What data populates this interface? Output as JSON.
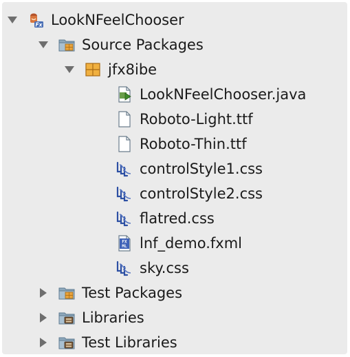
{
  "tree": {
    "project": {
      "label": "LookNFeelChooser",
      "icon": "javafx-project-icon",
      "expanded": true
    },
    "source_packages": {
      "label": "Source Packages",
      "icon": "source-folder-icon",
      "expanded": true
    },
    "package": {
      "label": "jfx8ibe",
      "icon": "package-icon",
      "expanded": true
    },
    "files": [
      {
        "label": "LookNFeelChooser.java",
        "icon": "java-file-icon"
      },
      {
        "label": "Roboto-Light.ttf",
        "icon": "blank-file-icon"
      },
      {
        "label": "Roboto-Thin.ttf",
        "icon": "blank-file-icon"
      },
      {
        "label": "controlStyle1.css",
        "icon": "css-file-icon"
      },
      {
        "label": "controlStyle2.css",
        "icon": "css-file-icon"
      },
      {
        "label": "flatred.css",
        "icon": "css-file-icon"
      },
      {
        "label": "lnf_demo.fxml",
        "icon": "fxml-file-icon"
      },
      {
        "label": "sky.css",
        "icon": "css-file-icon"
      }
    ],
    "test_packages": {
      "label": "Test Packages",
      "icon": "test-folder-icon",
      "expanded": false
    },
    "libraries": {
      "label": "Libraries",
      "icon": "library-folder-icon",
      "expanded": false
    },
    "test_libraries": {
      "label": "Test Libraries",
      "icon": "library-folder-icon",
      "expanded": false
    }
  },
  "colors": {
    "panel_background": "#ebebeb",
    "text": "#1a1a1a",
    "toggle_arrow": "#6e6e6e",
    "folder": "#9bb3c6",
    "package": "#e8a33b",
    "css_icon": "#2c4fa3"
  }
}
